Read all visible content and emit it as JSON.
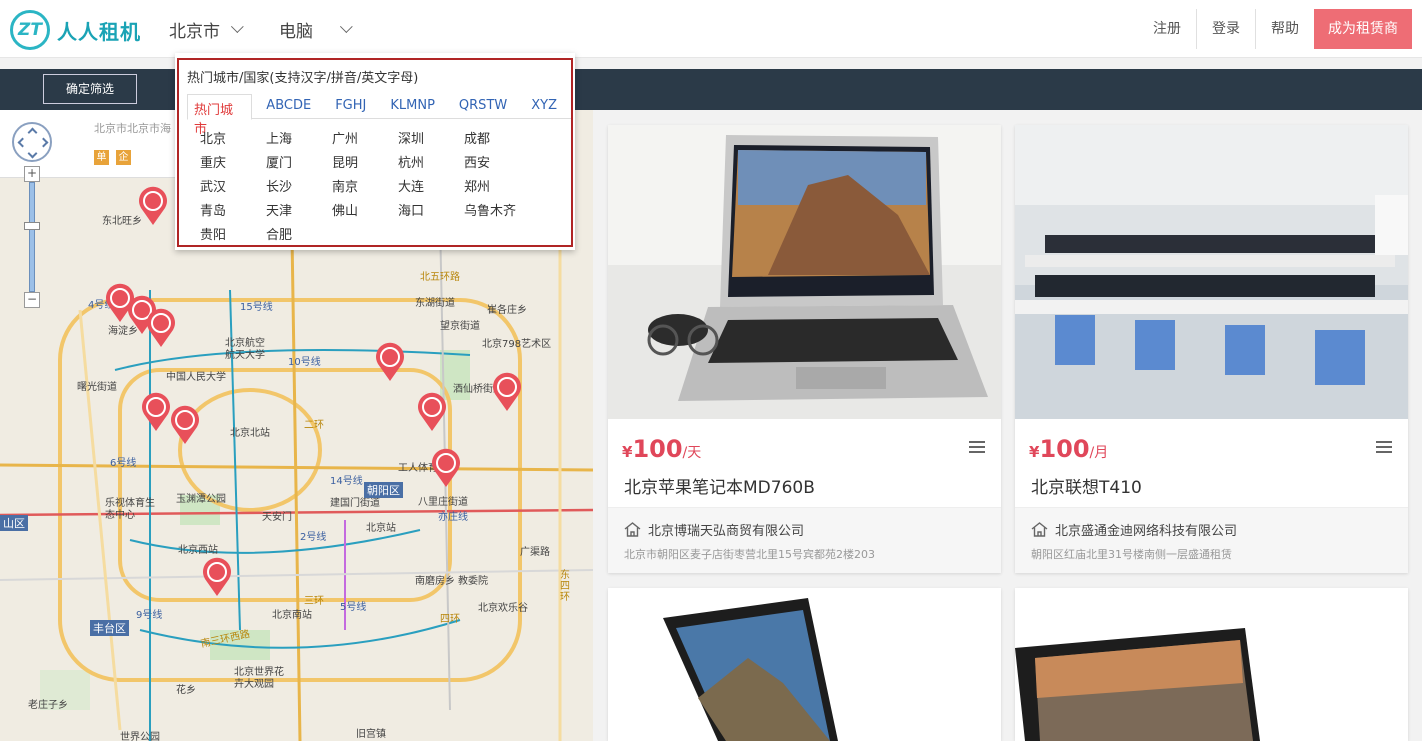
{
  "header": {
    "logo_mark": "ZT",
    "logo_text": "人人租机",
    "city_select": "北京市",
    "category_select": "电脑",
    "links": [
      "注册",
      "登录",
      "帮助"
    ],
    "become_btn": "成为租赁商"
  },
  "filter": {
    "confirm_btn": "确定筛选"
  },
  "city_dropdown": {
    "hint": "热门城市/国家(支持汉字/拼音/英文字母)",
    "tabs": [
      "热门城市",
      "ABCDE",
      "FGHJ",
      "KLMNP",
      "QRSTW",
      "XYZ"
    ],
    "active_tab": 0,
    "cities": [
      [
        "北京",
        "上海",
        "广州",
        "深圳",
        "成都"
      ],
      [
        "重庆",
        "厦门",
        "昆明",
        "杭州",
        "西安"
      ],
      [
        "武汉",
        "长沙",
        "南京",
        "大连",
        "郑州"
      ],
      [
        "青岛",
        "天津",
        "佛山",
        "海口",
        "乌鲁木齐"
      ],
      [
        "贵阳",
        "合肥"
      ]
    ]
  },
  "map": {
    "addr": "北京市北京市海",
    "badges": [
      "单",
      "企"
    ],
    "zoom_in": "+",
    "zoom_out": "−",
    "labels": [
      "东北旺乡",
      "海淀乡",
      "曙光街道",
      "北京航空航天大学",
      "中国人民大学",
      "北京北站",
      "乐视体育生态中心",
      "玉渊潭公园",
      "天安门",
      "建国门街道",
      "北京站",
      "北京西站",
      "工人体育场",
      "八里庄街道",
      "望京街道",
      "东湖街道",
      "崔各庄乡",
      "北京798艺术区",
      "酒仙桥街道",
      "北五环路",
      "广渠路",
      "南磨房乡",
      "教委院",
      "北京欢乐谷",
      "北京南站",
      "南三环西路",
      "北京世界花卉大观园",
      "花乡",
      "老庄子乡",
      "世界公园",
      "旧宫镇",
      "东四环"
    ],
    "districts": [
      "朝阳区",
      "丰台区",
      "山区"
    ],
    "metro": [
      "10号线",
      "15号线",
      "6号线",
      "2号线",
      "4号线",
      "9号线",
      "5号线",
      "14号线",
      "亦庄线"
    ],
    "roads": [
      "二环",
      "三环",
      "四环"
    ]
  },
  "products": [
    {
      "currency": "¥",
      "price": "100",
      "unit": "/天",
      "title": "北京苹果笔记本MD760B",
      "shop": "北京博瑞天弘商贸有限公司",
      "addr": "北京市朝阳区麦子店街枣营北里15号宾都苑2楼203"
    },
    {
      "currency": "¥",
      "price": "100",
      "unit": "/月",
      "title": "北京联想T410",
      "shop": "北京盛通金迪网络科技有限公司",
      "addr": "朝阳区红庙北里31号楼南侧一层盛通租赁"
    }
  ],
  "colors": {
    "brand": "#2bb5c4",
    "accent": "#ee6d75",
    "price": "#e0475a",
    "bar": "#2b3a48"
  }
}
